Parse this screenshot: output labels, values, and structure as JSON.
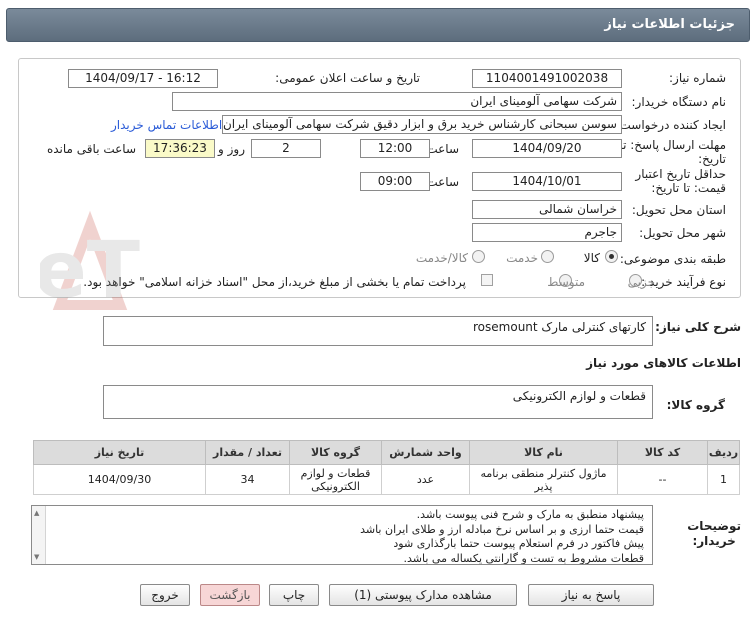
{
  "header": {
    "title": "جزئیات اطلاعات نیاز"
  },
  "form": {
    "need_number_label": "شماره نیاز:",
    "need_number": "1104001491002038",
    "announce_label": "تاریخ و ساعت اعلان عمومی:",
    "announce_value": "1404/09/17 - 16:12",
    "buyer_org_label": "نام دستگاه خریدار:",
    "buyer_org": "شرکت سهامی آلومینای ایران",
    "requester_label": "ایجاد کننده درخواست:",
    "requester": "سوسن سبحانی کارشناس خرید برق و ابزار دقیق شرکت سهامی آلومینای ایران",
    "contact_link": "اطلاعات تماس خریدار",
    "deadline_label_1": "مهلت ارسال پاسخ: تا",
    "deadline_label_2": "تاریخ:",
    "deadline_date": "1404/09/20",
    "time_label": "ساعت",
    "deadline_time": "12:00",
    "days_value": "2",
    "days_label": "روز و",
    "remaining_time": "17:36:23",
    "remaining_label": "ساعت باقی مانده",
    "validity_label_1": "حداقل تاریخ اعتبار",
    "validity_label_2": "قیمت: تا تاریخ:",
    "validity_date": "1404/10/01",
    "validity_time": "09:00",
    "province_label": "استان محل تحویل:",
    "province": "خراسان شمالی",
    "city_label": "شهر محل تحویل:",
    "city": "جاجرم",
    "category_label": "طبقه بندی موضوعی:",
    "category_options": [
      "کالا",
      "خدمت",
      "کالا/خدمت"
    ],
    "process_label": "نوع فرآیند خرید :",
    "process_options": [
      "جزیی",
      "متوسط"
    ],
    "process_note": "پرداخت تمام یا بخشی از مبلغ خرید،از محل \"اسناد خزانه اسلامی\" خواهد بود."
  },
  "summary": {
    "label": "شرح کلی نیاز:",
    "value": "کارتهای کنترلی مارک rosemount"
  },
  "goods_info": {
    "title": "اطلاعات کالاهای مورد نیاز",
    "group_label": "گروه کالا:",
    "group_value": "قطعات و لوازم الکترونیکی"
  },
  "table": {
    "headers": [
      "ردیف",
      "کد کالا",
      "نام کالا",
      "واحد شمارش",
      "گروه کالا",
      "تعداد / مقدار",
      "تاریخ نیاز"
    ],
    "rows": [
      [
        "1",
        "--",
        "ماژول کنترلر منطقی برنامه پذیر",
        "عدد",
        "قطعات و لوازم الکترونیکی",
        "34",
        "1404/09/30"
      ]
    ]
  },
  "notes": {
    "label_1": "توضیحات",
    "label_2": "خریدار:",
    "lines": [
      "پیشنهاد منطبق به مارک و شرح فنی پیوست باشد.",
      "قیمت حتما ارزی و بر اساس نرخ مبادله ارز و طلای ایران باشد",
      "پیش فاکتور در فرم استعلام پیوست حتما بارگذاری شود",
      "قطعات مشروط به تست و گارانتی یکساله می باشد."
    ]
  },
  "buttons": {
    "reply": "پاسخ به نیاز",
    "attachments": "مشاهده مدارک پیوستی (1)",
    "print": "چاپ",
    "back": "بازگشت",
    "exit": "خروج"
  },
  "watermark": {
    "text": "AriaTender.neT"
  },
  "colors": {
    "header": "#66788a",
    "link": "#2a5bd7",
    "highlight": "#fafac8"
  }
}
